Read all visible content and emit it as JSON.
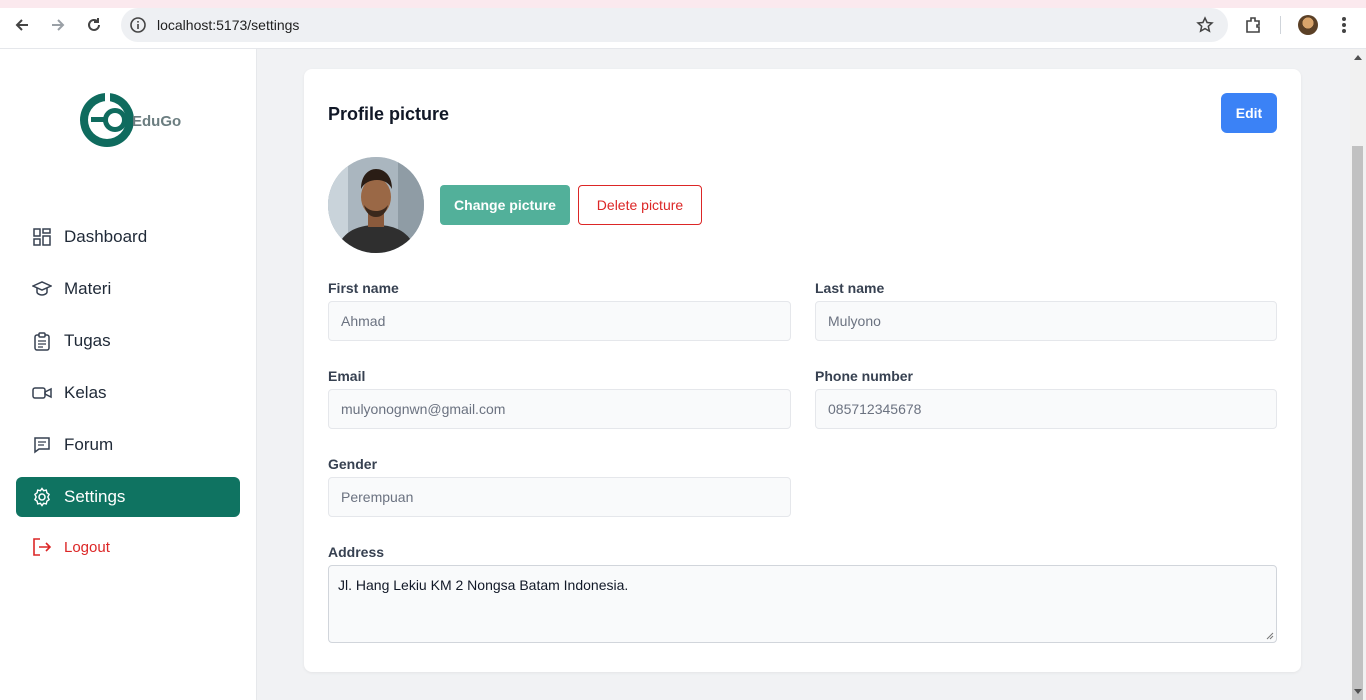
{
  "browser": {
    "url": "localhost:5173/settings"
  },
  "sidebar": {
    "logo_text": "EduGo",
    "items": [
      {
        "label": "Dashboard",
        "icon": "dashboard-icon"
      },
      {
        "label": "Materi",
        "icon": "graduation-cap-icon"
      },
      {
        "label": "Tugas",
        "icon": "clipboard-icon"
      },
      {
        "label": "Kelas",
        "icon": "video-icon"
      },
      {
        "label": "Forum",
        "icon": "chat-icon"
      },
      {
        "label": "Settings",
        "icon": "gear-icon",
        "active": true
      }
    ],
    "logout_label": "Logout"
  },
  "profile": {
    "title": "Profile picture",
    "edit_label": "Edit",
    "change_picture_label": "Change picture",
    "delete_picture_label": "Delete picture"
  },
  "form": {
    "first_name": {
      "label": "First name",
      "value": "Ahmad"
    },
    "last_name": {
      "label": "Last name",
      "value": "Mulyono"
    },
    "email": {
      "label": "Email",
      "value": "mulyonognwn@gmail.com"
    },
    "phone": {
      "label": "Phone number",
      "value": "085712345678"
    },
    "gender": {
      "label": "Gender",
      "value": "Perempuan"
    },
    "address": {
      "label": "Address",
      "value": "Jl. Hang Lekiu KM 2 Nongsa Batam Indonesia."
    }
  },
  "colors": {
    "primary_green": "#0f7361",
    "button_green": "#52b09a",
    "edit_blue": "#3b82f6",
    "danger_red": "#dc2626"
  }
}
